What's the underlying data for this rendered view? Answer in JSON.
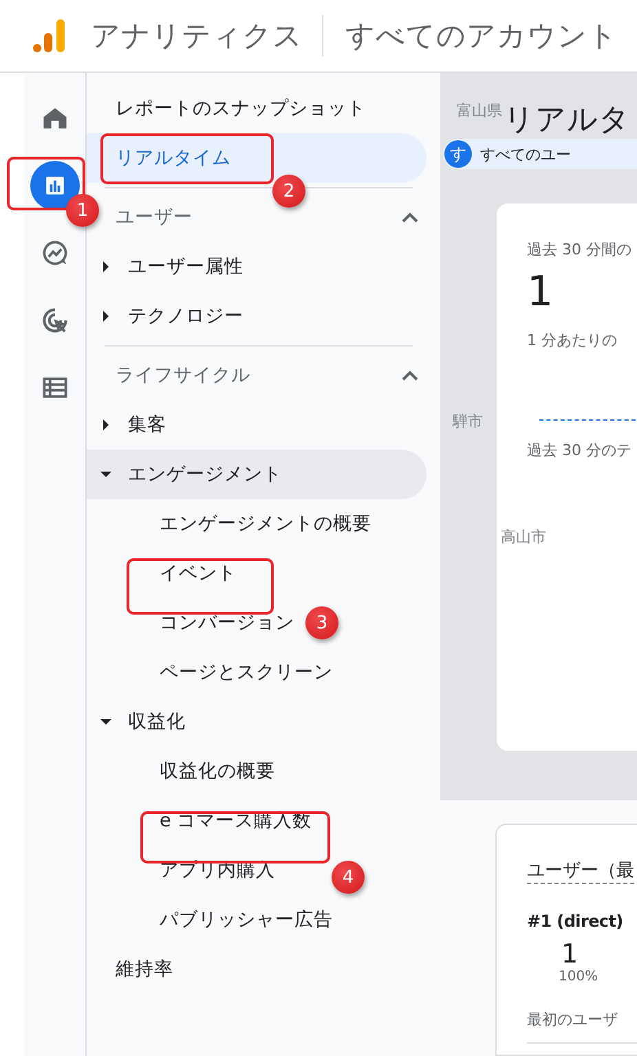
{
  "header": {
    "product": "アナリティクス",
    "account": "すべてのアカウント"
  },
  "rail": [
    {
      "selected": false
    },
    {
      "selected": true
    },
    {
      "selected": false
    },
    {
      "selected": false
    },
    {
      "selected": false
    }
  ],
  "nav": {
    "links": [
      {
        "label": "レポートのスナップショット",
        "selected": false
      },
      {
        "label": "リアルタイム",
        "selected": true
      }
    ],
    "sections": [
      {
        "title": "ユーザー",
        "expanded": true,
        "children": [
          {
            "kind": "group",
            "label": "ユーザー属性",
            "expanded": false,
            "selected": false
          },
          {
            "kind": "group",
            "label": "テクノロジー",
            "expanded": false,
            "selected": false
          }
        ]
      },
      {
        "title": "ライフサイクル",
        "expanded": true,
        "children": [
          {
            "kind": "group",
            "label": "集客",
            "expanded": false,
            "selected": false
          },
          {
            "kind": "group",
            "label": "エンゲージメント",
            "expanded": true,
            "selected": true,
            "children": [
              {
                "label": "エンゲージメントの概要",
                "selected": false
              },
              {
                "label": "イベント",
                "selected": false
              },
              {
                "label": "コンバージョン",
                "selected": false
              },
              {
                "label": "ページとスクリーン",
                "selected": false
              }
            ]
          },
          {
            "kind": "group",
            "label": "収益化",
            "expanded": true,
            "selected": false,
            "children": [
              {
                "label": "収益化の概要",
                "selected": false
              },
              {
                "label": "e コマース購入数",
                "selected": false
              },
              {
                "label": "アプリ内購入",
                "selected": false
              },
              {
                "label": "パブリッシャー広告",
                "selected": false
              }
            ]
          },
          {
            "kind": "link",
            "label": "維持率",
            "selected": false
          }
        ]
      }
    ]
  },
  "main": {
    "title": "リアルタ",
    "map_labels": [
      "富山県",
      "騨市",
      "高山市"
    ],
    "chip": {
      "initial": "す",
      "label": "すべてのユー"
    },
    "card": {
      "metric_label": "過去 30 分間の",
      "value": "1",
      "per_minute_label": "1 分あたりの",
      "chart_label": "過去 30 分のテ"
    },
    "users_card": {
      "title": "ユーザー（最",
      "rank": "#1 (direct)",
      "value": "1",
      "share": "100%",
      "footer": "最初のユーザ"
    }
  },
  "annotations": [
    {
      "number": "1"
    },
    {
      "number": "2"
    },
    {
      "number": "3"
    },
    {
      "number": "4"
    }
  ]
}
